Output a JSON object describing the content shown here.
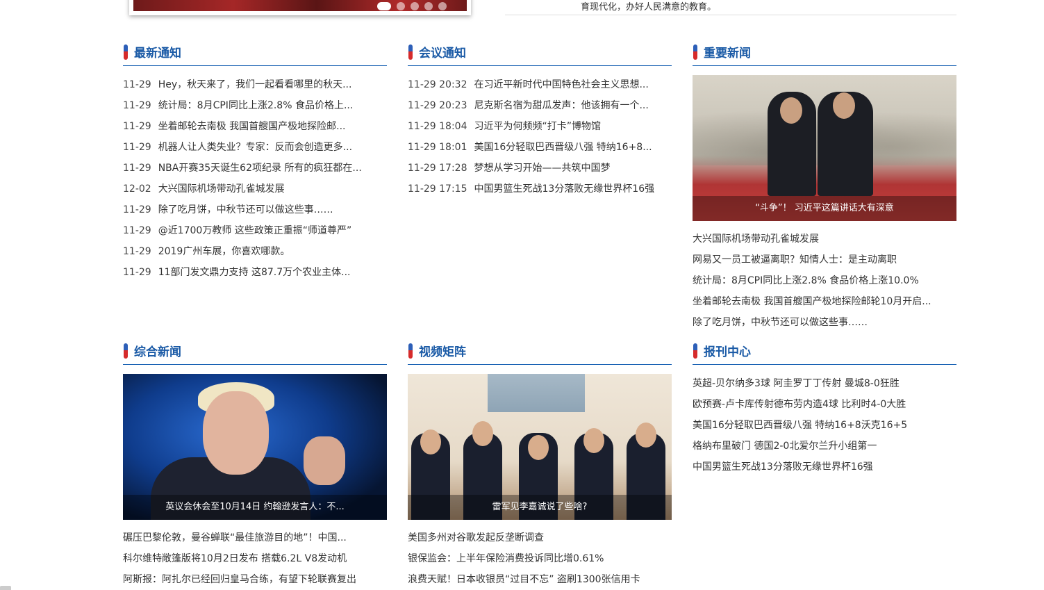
{
  "top": {
    "slider_dots": 5,
    "active_dot": 1,
    "text": "育现代化，办好人民满意的教育。"
  },
  "latest": {
    "title": "最新通知",
    "items": [
      {
        "date": "11-29",
        "text": "Hey，秋天来了，我们一起看看哪里的秋天..."
      },
      {
        "date": "11-29",
        "text": "统计局：8月CPI同比上涨2.8% 食品价格上..."
      },
      {
        "date": "11-29",
        "text": "坐着邮轮去南极 我国首艘国产极地探险邮..."
      },
      {
        "date": "11-29",
        "text": "机器人让人类失业？专家：反而会创造更多..."
      },
      {
        "date": "11-29",
        "text": "NBA开赛35天诞生62项纪录 所有的疯狂都在..."
      },
      {
        "date": "12-02",
        "text": "大兴国际机场带动孔雀城发展"
      },
      {
        "date": "11-29",
        "text": "除了吃月饼，中秋节还可以做这些事……"
      },
      {
        "date": "11-29",
        "text": "@近1700万教师 这些政策正重振“师道尊严”"
      },
      {
        "date": "11-29",
        "text": "2019广州车展，你喜欢哪款。"
      },
      {
        "date": "11-29",
        "text": "11部门发文鼎力支持 这87.7万个农业主体..."
      }
    ]
  },
  "meeting": {
    "title": "会议通知",
    "items": [
      {
        "date": "11-29 20:32",
        "text": "在习近平新时代中国特色社会主义思想..."
      },
      {
        "date": "11-29 20:23",
        "text": "尼克斯名宿为甜瓜发声：他该拥有一个..."
      },
      {
        "date": "11-29 18:04",
        "text": "习近平为何频频“打卡”博物馆"
      },
      {
        "date": "11-29 18:01",
        "text": "美国16分轻取巴西晋级八强 特纳16+8..."
      },
      {
        "date": "11-29 17:28",
        "text": "梦想从学习开始——共筑中国梦"
      },
      {
        "date": "11-29 17:15",
        "text": "中国男篮生死战13分落败无缘世界杯16强"
      }
    ]
  },
  "important": {
    "title": "重要新闻",
    "photo_caption": "“斗争”！ 习近平这篇讲话大有深意",
    "items": [
      "大兴国际机场带动孔雀城发展",
      "网易又一员工被逼离职？知情人士：是主动离职",
      "统计局：8月CPI同比上涨2.8% 食品价格上涨10.0%",
      "坐着邮轮去南极 我国首艘国产极地探险邮轮10月开启...",
      "除了吃月饼，中秋节还可以做这些事……"
    ]
  },
  "general": {
    "title": "综合新闻",
    "photo_caption": "英议会休会至10月14日 约翰逊发言人：不...",
    "items": [
      "碾压巴黎伦敦，曼谷蝉联“最佳旅游目的地”！中国...",
      "科尔维特敞篷版将10月2日发布 搭载6.2L V8发动机",
      "阿斯报：阿扎尔已经回归皇马合练，有望下轮联赛复出"
    ]
  },
  "video": {
    "title": "视频矩阵",
    "photo_caption": "雷军见李嘉诚说了些啥?",
    "items": [
      "美国多州对谷歌发起反垄断调查",
      "银保监会：上半年保险消费投诉同比增0.61%",
      "浪费天赋！日本收银员“过目不忘” 盗刷1300张信用卡"
    ]
  },
  "newspaper": {
    "title": "报刊中心",
    "items": [
      "英超-贝尔纳多3球 阿圭罗丁丁传射 曼城8-0狂胜",
      "欧预赛-卢卡库传射德布劳内造4球 比利时4-0大胜",
      "美国16分轻取巴西晋级八强 特纳16+8沃克16+5",
      "格纳布里破门 德国2-0北爱尔兰升小组第一",
      "中国男篮生死战13分落败无缘世界杯16强"
    ]
  }
}
